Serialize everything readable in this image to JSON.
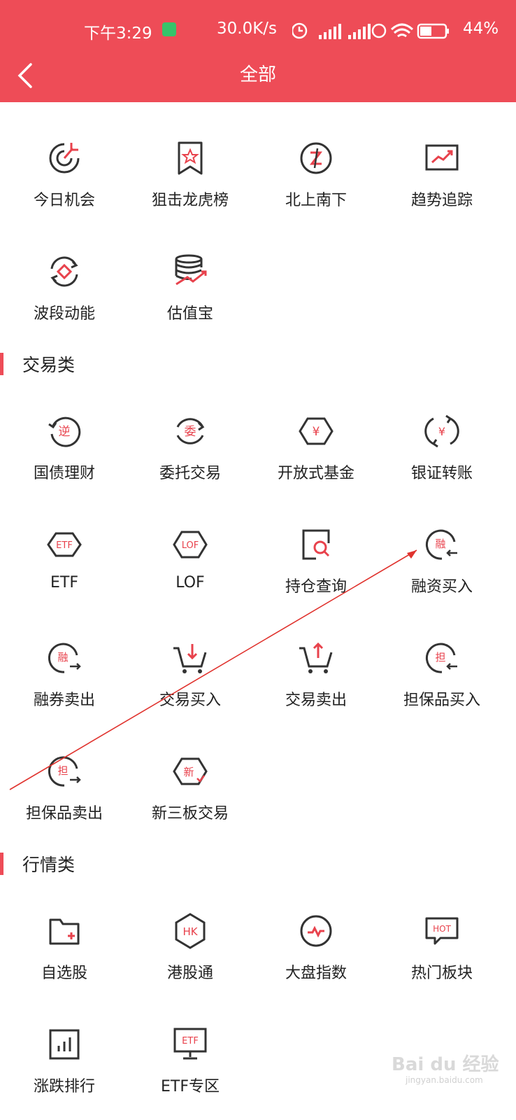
{
  "status_bar": {
    "time": "下午3:29",
    "speed": "30.0K/s",
    "battery": "44%"
  },
  "nav": {
    "title": "全部"
  },
  "sections": {
    "top": {
      "items": [
        "今日机会",
        "狙击龙虎榜",
        "北上南下",
        "趋势追踪",
        "波段动能",
        "估值宝"
      ]
    },
    "trade": {
      "title": "交易类",
      "items": [
        "国债理财",
        "委托交易",
        "开放式基金",
        "银证转账",
        "ETF",
        "LOF",
        "持仓查询",
        "融资买入",
        "融券卖出",
        "交易买入",
        "交易卖出",
        "担保品买入",
        "担保品卖出",
        "新三板交易"
      ]
    },
    "market": {
      "title": "行情类",
      "items": [
        "自选股",
        "港股通",
        "大盘指数",
        "热门板块",
        "涨跌排行",
        "ETF专区"
      ]
    }
  },
  "icon_glyphs": {
    "reverse": "逆",
    "entrust": "委",
    "yuan": "¥",
    "etf": "ETF",
    "lof": "LOF",
    "margin": "融",
    "guarantee": "担",
    "neeq": "新",
    "hk": "HK",
    "hot": "HOT",
    "etfzone": "ETF"
  },
  "watermark": {
    "brand": "Bai du 经验",
    "url": "jingyan.baidu.com"
  },
  "colors": {
    "accent": "#ee4c57",
    "icon_stroke": "#333333",
    "icon_red": "#e8424c"
  }
}
